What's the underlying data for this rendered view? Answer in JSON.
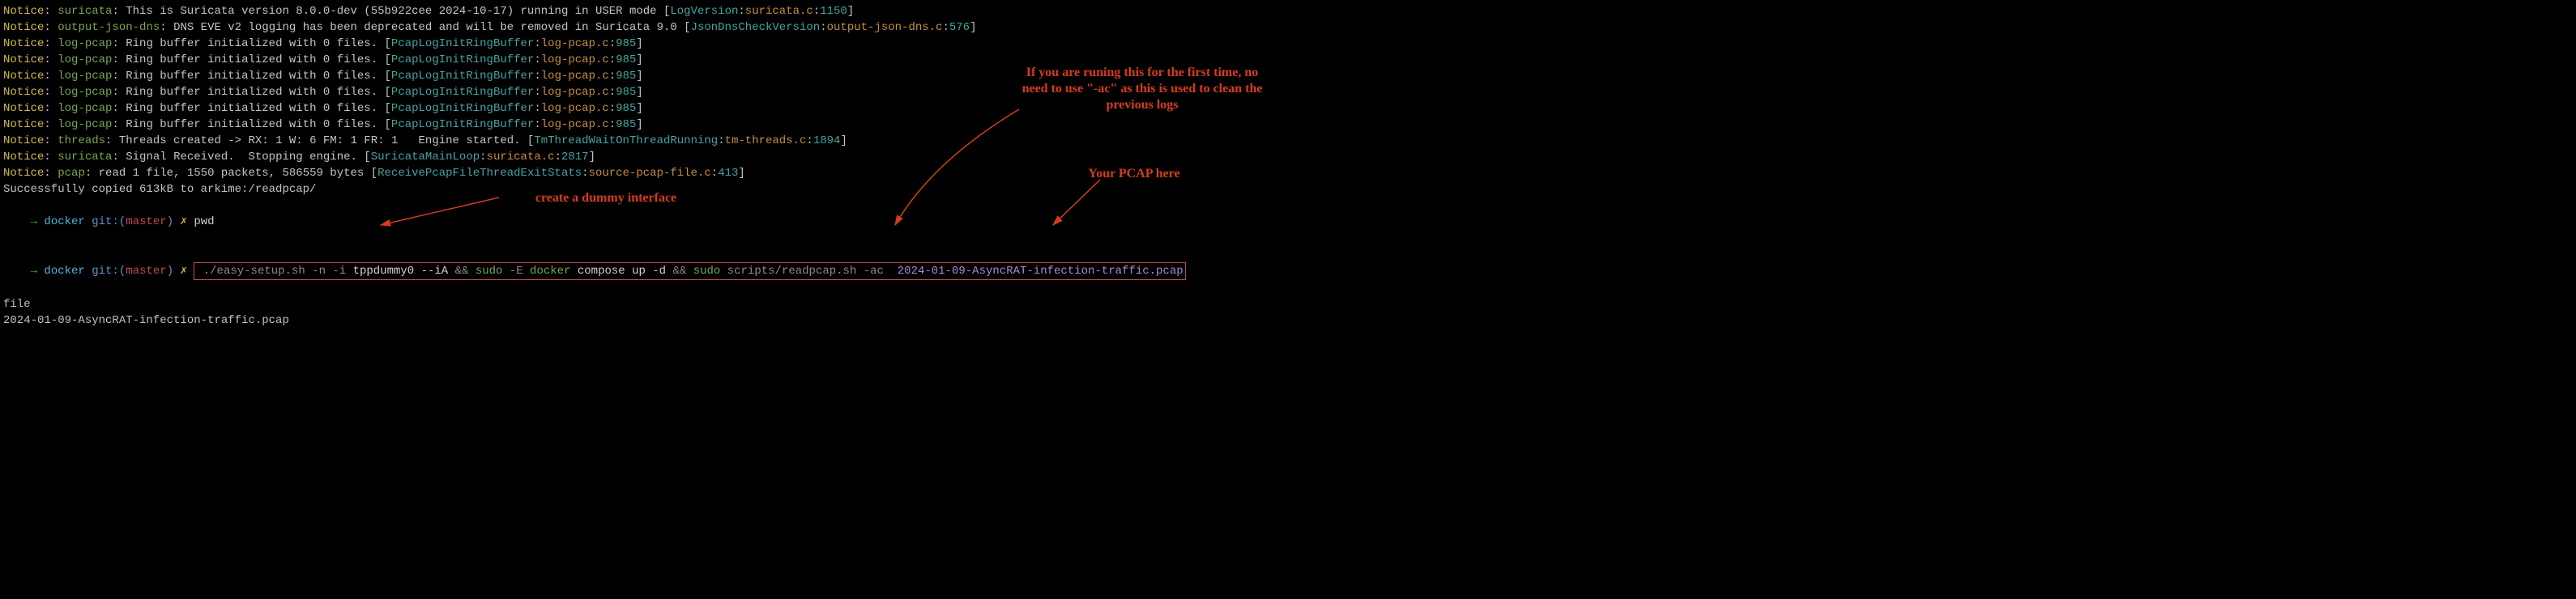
{
  "lines": [
    {
      "segments": [
        {
          "cls": "yellow",
          "t": "Notice"
        },
        {
          "cls": "white",
          "t": ": "
        },
        {
          "cls": "green",
          "t": "suricata"
        },
        {
          "cls": "white",
          "t": ": This is Suricata version 8.0.0-dev (55b922cee 2024-10-17) running in USER mode ["
        },
        {
          "cls": "cyan",
          "t": "LogVersion"
        },
        {
          "cls": "white",
          "t": ":"
        },
        {
          "cls": "orange",
          "t": "suricata.c"
        },
        {
          "cls": "white",
          "t": ":"
        },
        {
          "cls": "cyan",
          "t": "1150"
        },
        {
          "cls": "white",
          "t": "]"
        }
      ]
    },
    {
      "segments": [
        {
          "cls": "yellow",
          "t": "Notice"
        },
        {
          "cls": "white",
          "t": ": "
        },
        {
          "cls": "green",
          "t": "output-json-dns"
        },
        {
          "cls": "white",
          "t": ": DNS EVE v2 logging has been deprecated and will be removed in Suricata 9.0 ["
        },
        {
          "cls": "cyan",
          "t": "JsonDnsCheckVersion"
        },
        {
          "cls": "white",
          "t": ":"
        },
        {
          "cls": "orange",
          "t": "output-json-dns.c"
        },
        {
          "cls": "white",
          "t": ":"
        },
        {
          "cls": "cyan",
          "t": "576"
        },
        {
          "cls": "white",
          "t": "]"
        }
      ]
    },
    {
      "segments": [
        {
          "cls": "yellow",
          "t": "Notice"
        },
        {
          "cls": "white",
          "t": ": "
        },
        {
          "cls": "green",
          "t": "log-pcap"
        },
        {
          "cls": "white",
          "t": ": Ring buffer initialized with 0 files. ["
        },
        {
          "cls": "cyan",
          "t": "PcapLogInitRingBuffer"
        },
        {
          "cls": "white",
          "t": ":"
        },
        {
          "cls": "orange",
          "t": "log-pcap.c"
        },
        {
          "cls": "white",
          "t": ":"
        },
        {
          "cls": "cyan",
          "t": "985"
        },
        {
          "cls": "white",
          "t": "]"
        }
      ]
    },
    {
      "segments": [
        {
          "cls": "yellow",
          "t": "Notice"
        },
        {
          "cls": "white",
          "t": ": "
        },
        {
          "cls": "green",
          "t": "log-pcap"
        },
        {
          "cls": "white",
          "t": ": Ring buffer initialized with 0 files. ["
        },
        {
          "cls": "cyan",
          "t": "PcapLogInitRingBuffer"
        },
        {
          "cls": "white",
          "t": ":"
        },
        {
          "cls": "orange",
          "t": "log-pcap.c"
        },
        {
          "cls": "white",
          "t": ":"
        },
        {
          "cls": "cyan",
          "t": "985"
        },
        {
          "cls": "white",
          "t": "]"
        }
      ]
    },
    {
      "segments": [
        {
          "cls": "yellow",
          "t": "Notice"
        },
        {
          "cls": "white",
          "t": ": "
        },
        {
          "cls": "green",
          "t": "log-pcap"
        },
        {
          "cls": "white",
          "t": ": Ring buffer initialized with 0 files. ["
        },
        {
          "cls": "cyan",
          "t": "PcapLogInitRingBuffer"
        },
        {
          "cls": "white",
          "t": ":"
        },
        {
          "cls": "orange",
          "t": "log-pcap.c"
        },
        {
          "cls": "white",
          "t": ":"
        },
        {
          "cls": "cyan",
          "t": "985"
        },
        {
          "cls": "white",
          "t": "]"
        }
      ]
    },
    {
      "segments": [
        {
          "cls": "yellow",
          "t": "Notice"
        },
        {
          "cls": "white",
          "t": ": "
        },
        {
          "cls": "green",
          "t": "log-pcap"
        },
        {
          "cls": "white",
          "t": ": Ring buffer initialized with 0 files. ["
        },
        {
          "cls": "cyan",
          "t": "PcapLogInitRingBuffer"
        },
        {
          "cls": "white",
          "t": ":"
        },
        {
          "cls": "orange",
          "t": "log-pcap.c"
        },
        {
          "cls": "white",
          "t": ":"
        },
        {
          "cls": "cyan",
          "t": "985"
        },
        {
          "cls": "white",
          "t": "]"
        }
      ]
    },
    {
      "segments": [
        {
          "cls": "yellow",
          "t": "Notice"
        },
        {
          "cls": "white",
          "t": ": "
        },
        {
          "cls": "green",
          "t": "log-pcap"
        },
        {
          "cls": "white",
          "t": ": Ring buffer initialized with 0 files. ["
        },
        {
          "cls": "cyan",
          "t": "PcapLogInitRingBuffer"
        },
        {
          "cls": "white",
          "t": ":"
        },
        {
          "cls": "orange",
          "t": "log-pcap.c"
        },
        {
          "cls": "white",
          "t": ":"
        },
        {
          "cls": "cyan",
          "t": "985"
        },
        {
          "cls": "white",
          "t": "]"
        }
      ]
    },
    {
      "segments": [
        {
          "cls": "yellow",
          "t": "Notice"
        },
        {
          "cls": "white",
          "t": ": "
        },
        {
          "cls": "green",
          "t": "log-pcap"
        },
        {
          "cls": "white",
          "t": ": Ring buffer initialized with 0 files. ["
        },
        {
          "cls": "cyan",
          "t": "PcapLogInitRingBuffer"
        },
        {
          "cls": "white",
          "t": ":"
        },
        {
          "cls": "orange",
          "t": "log-pcap.c"
        },
        {
          "cls": "white",
          "t": ":"
        },
        {
          "cls": "cyan",
          "t": "985"
        },
        {
          "cls": "white",
          "t": "]"
        }
      ]
    },
    {
      "segments": [
        {
          "cls": "yellow",
          "t": "Notice"
        },
        {
          "cls": "white",
          "t": ": "
        },
        {
          "cls": "green",
          "t": "threads"
        },
        {
          "cls": "white",
          "t": ": Threads created -> RX: 1 W: 6 FM: 1 FR: 1   Engine started. ["
        },
        {
          "cls": "cyan",
          "t": "TmThreadWaitOnThreadRunning"
        },
        {
          "cls": "white",
          "t": ":"
        },
        {
          "cls": "orange",
          "t": "tm-threads.c"
        },
        {
          "cls": "white",
          "t": ":"
        },
        {
          "cls": "cyan",
          "t": "1894"
        },
        {
          "cls": "white",
          "t": "]"
        }
      ]
    },
    {
      "segments": [
        {
          "cls": "yellow",
          "t": "Notice"
        },
        {
          "cls": "white",
          "t": ": "
        },
        {
          "cls": "green",
          "t": "suricata"
        },
        {
          "cls": "white",
          "t": ": Signal Received.  Stopping engine. ["
        },
        {
          "cls": "cyan",
          "t": "SuricataMainLoop"
        },
        {
          "cls": "white",
          "t": ":"
        },
        {
          "cls": "orange",
          "t": "suricata.c"
        },
        {
          "cls": "white",
          "t": ":"
        },
        {
          "cls": "cyan",
          "t": "2817"
        },
        {
          "cls": "white",
          "t": "]"
        }
      ]
    },
    {
      "segments": [
        {
          "cls": "yellow",
          "t": "Notice"
        },
        {
          "cls": "white",
          "t": ": "
        },
        {
          "cls": "green",
          "t": "pcap"
        },
        {
          "cls": "white",
          "t": ": read 1 file, 1550 packets, 586559 bytes ["
        },
        {
          "cls": "cyan",
          "t": "ReceivePcapFileThreadExitStats"
        },
        {
          "cls": "white",
          "t": ":"
        },
        {
          "cls": "orange",
          "t": "source-pcap-file.c"
        },
        {
          "cls": "white",
          "t": ":"
        },
        {
          "cls": "cyan",
          "t": "413"
        },
        {
          "cls": "white",
          "t": "]"
        }
      ]
    },
    {
      "segments": [
        {
          "cls": "white",
          "t": "Successfully copied 613kB to arkime:/readpcap/"
        }
      ]
    }
  ],
  "prompt1": {
    "arrow": "→",
    "dir": "docker",
    "git1": "git:(",
    "branch": "master",
    "git2": ")",
    "x": "✗",
    "cmd": "pwd"
  },
  "prompt2": {
    "arrow": "→",
    "dir": "docker",
    "git1": "git:(",
    "branch": "master",
    "git2": ")",
    "x": "✗",
    "parts": [
      {
        "cls": "cmd-grey",
        "t": " ./easy-setup.sh -n -i "
      },
      {
        "cls": "cmd-white",
        "t": "tppdummy0 --iA "
      },
      {
        "cls": "cmd-grey",
        "t": "&& "
      },
      {
        "cls": "cmd-green",
        "t": "sudo"
      },
      {
        "cls": "cmd-grey",
        "t": " -E "
      },
      {
        "cls": "cmd-green",
        "t": "docker"
      },
      {
        "cls": "cmd-white",
        "t": " compose up -d "
      },
      {
        "cls": "cmd-grey",
        "t": "&& "
      },
      {
        "cls": "cmd-green",
        "t": "sudo"
      },
      {
        "cls": "cmd-grey",
        "t": " scripts/readpcap.sh -ac  "
      },
      {
        "cls": "cmd-purple",
        "t": "2024-01-09-AsyncRAT-infection-traffic.pcap"
      }
    ]
  },
  "tail": [
    "file",
    "2024-01-09-AsyncRAT-infection-traffic.pcap"
  ],
  "annotations": {
    "dummy": "create a dummy interface",
    "firsttime": "If you are runing this for the first time, no need to use \"-ac\" as this is used to clean the previous logs",
    "pcap": "Your PCAP here"
  },
  "colors": {
    "annotation": "#d63b1f",
    "box": "#c44b4b"
  }
}
